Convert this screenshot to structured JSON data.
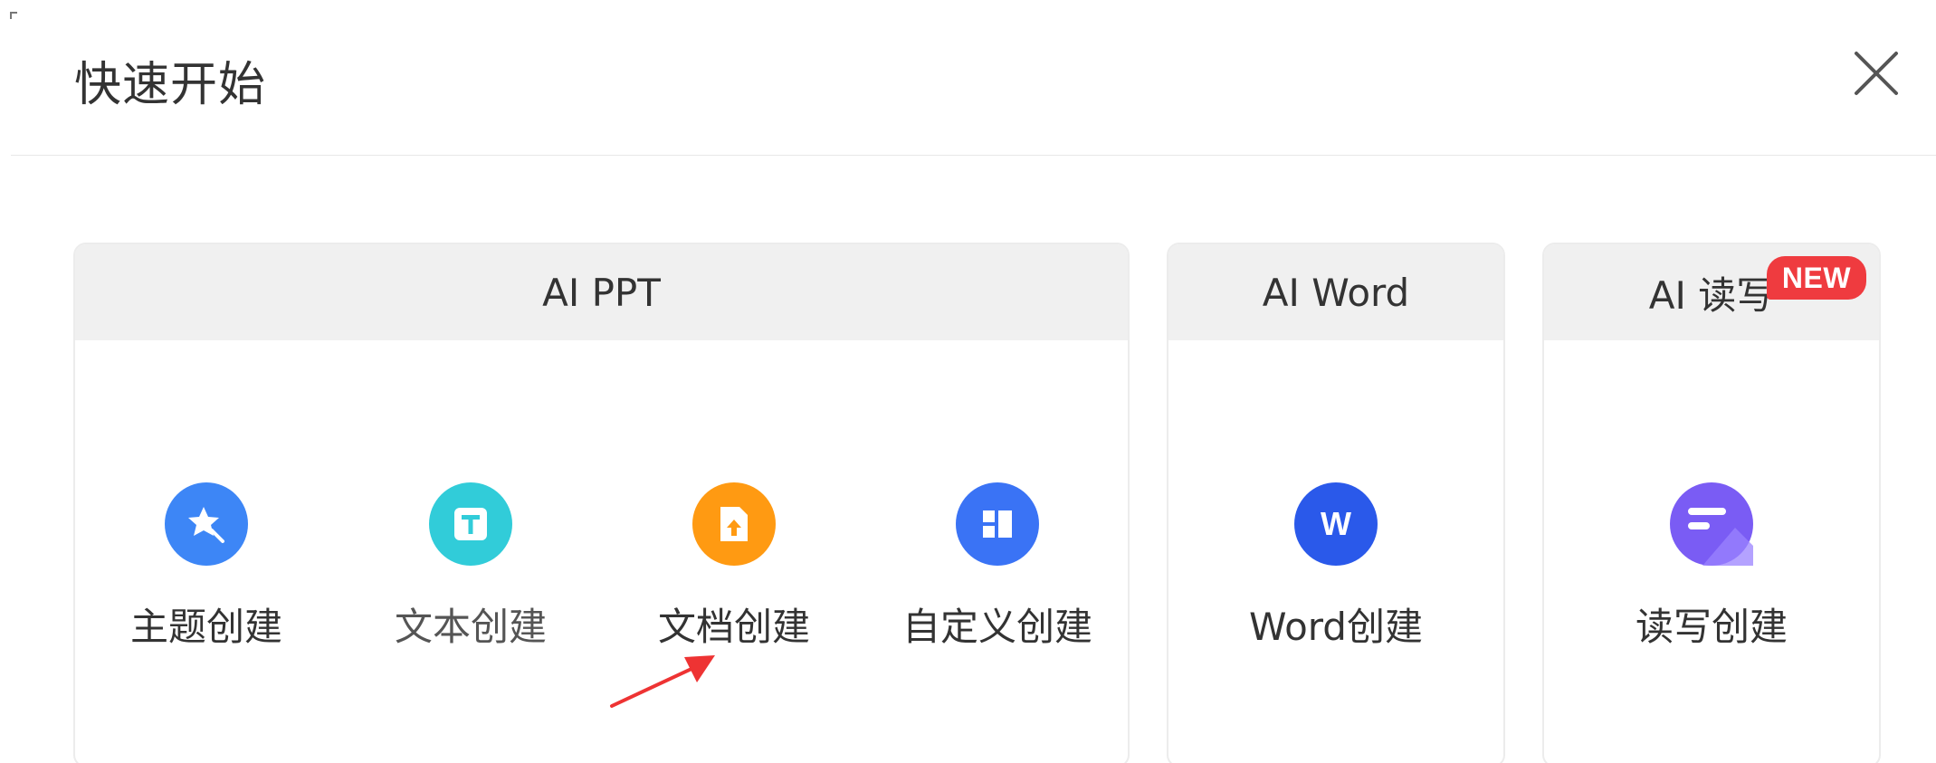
{
  "dialog": {
    "title": "快速开始",
    "close_label": "×"
  },
  "sections": {
    "ppt": {
      "title": "AI PPT",
      "items": [
        {
          "label": "主题创建",
          "icon": "magic-star-icon",
          "color": "#3d86f6"
        },
        {
          "label": "文本创建",
          "icon": "text-t-icon",
          "color": "#31ccd9"
        },
        {
          "label": "文档创建",
          "icon": "document-upload-icon",
          "color": "#ff9a12"
        },
        {
          "label": "自定义创建",
          "icon": "layout-grid-icon",
          "color": "#3a73f5"
        }
      ]
    },
    "word": {
      "title": "AI Word",
      "items": [
        {
          "label": "Word创建",
          "icon": "word-w-icon",
          "color": "#2a59ea"
        }
      ]
    },
    "read_write": {
      "title": "AI 读写",
      "badge": "NEW",
      "items": [
        {
          "label": "读写创建",
          "icon": "read-write-icon",
          "color": "#7a5cf4"
        }
      ]
    }
  },
  "annotation": {
    "color": "#ee3333"
  }
}
